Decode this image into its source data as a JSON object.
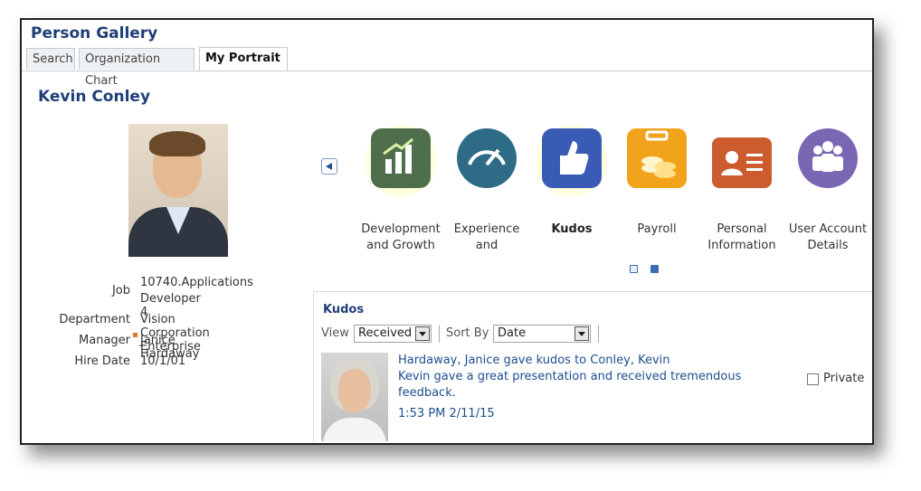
{
  "app_title": "Person Gallery",
  "tabs": [
    {
      "label": "Search"
    },
    {
      "label": "Organization Chart"
    },
    {
      "label": "My Portrait"
    }
  ],
  "person": {
    "name": "Kevin Conley",
    "fields": [
      {
        "label": "Job",
        "value_line1": "10740.Applications",
        "value_line2": "Developer 4"
      },
      {
        "label": "Department",
        "value": "Vision Corporation Enterprise"
      },
      {
        "label": "Manager",
        "value": "Janice Hardaway"
      },
      {
        "label": "Hire Date",
        "value": "10/1/01"
      }
    ]
  },
  "tiles": [
    {
      "line1": "Development",
      "line2": "and Growth",
      "icon": "chart-icon",
      "color": "#4f6e4c"
    },
    {
      "line1": "Experience",
      "line2": "and",
      "icon": "gauge-icon",
      "color": "#2d6b86"
    },
    {
      "line1": "Kudos",
      "line2": "",
      "icon": "thumbs-up-icon",
      "color": "#3a5bb5"
    },
    {
      "line1": "Payroll",
      "line2": "",
      "icon": "coins-icon",
      "color": "#f2a31c"
    },
    {
      "line1": "Personal",
      "line2": "Information",
      "icon": "id-card-icon",
      "color": "#cc5b2e"
    },
    {
      "line1": "User Account",
      "line2": "Details",
      "icon": "users-icon",
      "color": "#7a67b4"
    }
  ],
  "kudos": {
    "title": "Kudos",
    "view_label": "View",
    "view_value": "Received",
    "sort_label": "Sort By",
    "sort_value": "Date",
    "entry": {
      "headline": "Hardaway, Janice  gave kudos to  Conley, Kevin",
      "message_line1": "Kevin gave a great presentation and received tremendous",
      "message_line2": "feedback.",
      "timestamp": "1:53 PM  2/11/15",
      "private_label": "Private"
    }
  }
}
